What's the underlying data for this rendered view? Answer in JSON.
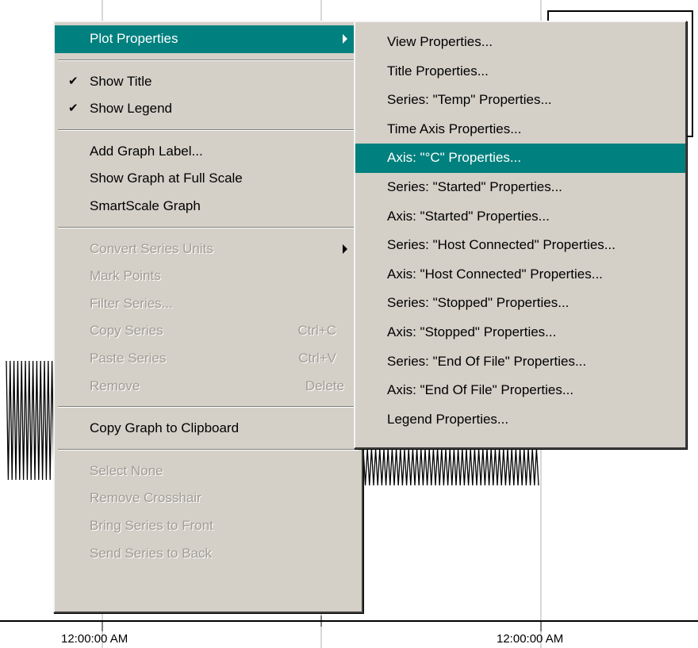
{
  "graph": {
    "x_tick_labels": [
      "12:00:00 AM",
      "12:00:00 AM"
    ]
  },
  "context_menu": {
    "plot_properties": {
      "label": "Plot Properties",
      "icon": "submenu-arrow-icon"
    },
    "show_title": {
      "label": "Show Title",
      "checked": true,
      "icon": "checkmark-icon"
    },
    "show_legend": {
      "label": "Show Legend",
      "checked": true,
      "icon": "checkmark-icon"
    },
    "add_graph_label": {
      "label": "Add Graph Label..."
    },
    "show_full_scale": {
      "label": "Show Graph at Full Scale"
    },
    "smartscale": {
      "label": "SmartScale Graph"
    },
    "convert_series_units": {
      "label": "Convert Series Units",
      "enabled": false,
      "icon": "submenu-arrow-icon"
    },
    "mark_points": {
      "label": "Mark Points",
      "enabled": false
    },
    "filter_series": {
      "label": "Filter Series...",
      "enabled": false
    },
    "copy_series": {
      "label": "Copy Series",
      "shortcut": "Ctrl+C",
      "enabled": false
    },
    "paste_series": {
      "label": "Paste Series",
      "shortcut": "Ctrl+V",
      "enabled": false
    },
    "remove": {
      "label": "Remove",
      "shortcut": "Delete",
      "enabled": false
    },
    "copy_graph": {
      "label": "Copy Graph to Clipboard"
    },
    "select_none": {
      "label": "Select None",
      "enabled": false
    },
    "remove_crosshair": {
      "label": "Remove Crosshair",
      "enabled": false
    },
    "bring_to_front": {
      "label": "Bring Series to Front",
      "enabled": false
    },
    "send_to_back": {
      "label": "Send Series to Back",
      "enabled": false
    }
  },
  "submenu": {
    "items": [
      {
        "label": "View Properties..."
      },
      {
        "label": "Title Properties..."
      },
      {
        "label": "Series: \"Temp\" Properties..."
      },
      {
        "label": "Time Axis Properties..."
      },
      {
        "label": "Axis: \"°C\" Properties...",
        "highlighted": true
      },
      {
        "label": "Series: \"Started\" Properties..."
      },
      {
        "label": "Axis: \"Started\" Properties..."
      },
      {
        "label": "Series: \"Host Connected\" Properties..."
      },
      {
        "label": "Axis: \"Host Connected\" Properties..."
      },
      {
        "label": "Series: \"Stopped\" Properties..."
      },
      {
        "label": "Axis: \"Stopped\" Properties..."
      },
      {
        "label": "Series: \"End Of File\" Properties..."
      },
      {
        "label": "Axis: \"End Of File\" Properties..."
      },
      {
        "label": "Legend Properties..."
      }
    ]
  },
  "colors": {
    "menu_bg": "#d4d0c8",
    "highlight": "#00807e",
    "disabled_text": "#a19d94"
  }
}
